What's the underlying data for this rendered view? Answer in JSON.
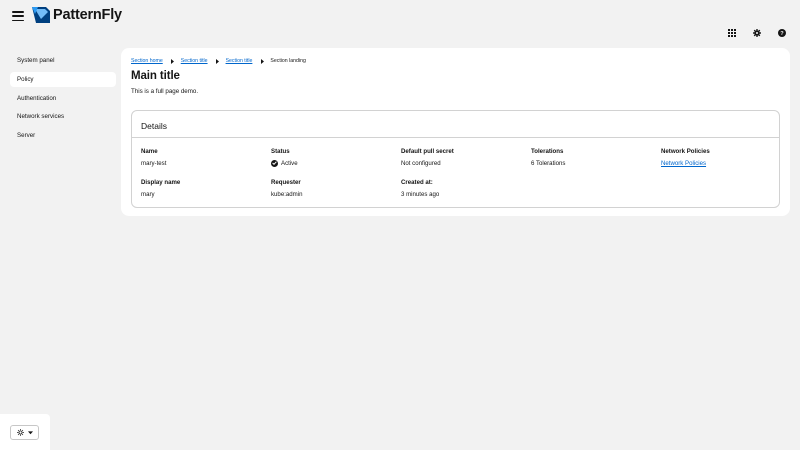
{
  "masthead": {
    "logo_text": "PatternFly",
    "icons": [
      "apps-grid-icon",
      "settings-gear-icon",
      "help-icon"
    ]
  },
  "nav": {
    "items": [
      {
        "label": "System panel",
        "current": false
      },
      {
        "label": "Policy",
        "current": true
      },
      {
        "label": "Authentication",
        "current": false
      },
      {
        "label": "Network services",
        "current": false
      },
      {
        "label": "Server",
        "current": false
      }
    ]
  },
  "theme": {
    "icon": "sun-icon"
  },
  "breadcrumb": {
    "items": [
      {
        "label": "Section home",
        "link": true
      },
      {
        "label": "Section title",
        "link": true
      },
      {
        "label": "Section title",
        "link": true
      },
      {
        "label": "Section landing",
        "link": false
      }
    ]
  },
  "page": {
    "title": "Main title",
    "description": "This is a full page demo."
  },
  "details": {
    "title": "Details",
    "name_label": "Name",
    "name_value": "mary-test",
    "status_label": "Status",
    "status_value": "Active",
    "pull_secret_label": "Default pull secret",
    "pull_secret_value": "Not configured",
    "tolerations_label": "Tolerations",
    "tolerations_value": "6 Tolerations",
    "network_label": "Network Policies",
    "network_value": "Network Policies",
    "display_name_label": "Display name",
    "display_name_value": "mary",
    "requester_label": "Requester",
    "requester_value": "kube:admin",
    "created_label": "Created at:",
    "created_value": "3 minutes ago"
  },
  "colors": {
    "background": "#f2f2f2",
    "link": "#0066cc",
    "logo_dark": "#004080",
    "logo_light": "#73bcf7"
  }
}
